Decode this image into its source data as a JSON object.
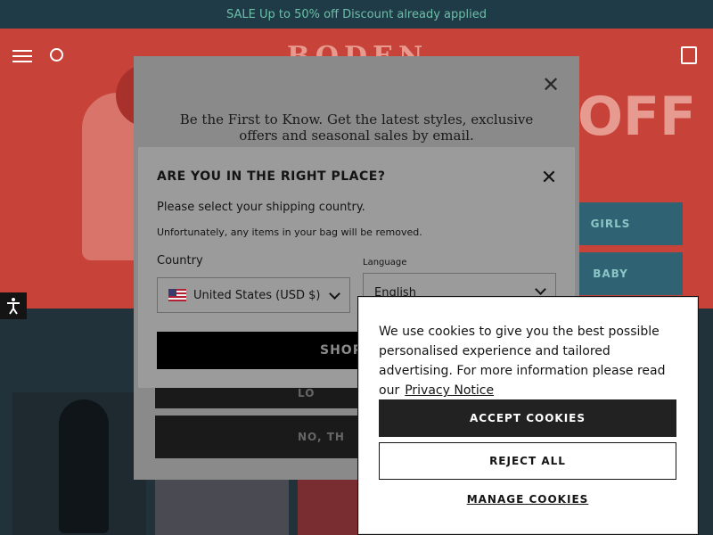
{
  "announcement": {
    "text": "SALE Up to 50% off Discount already applied"
  },
  "header": {
    "brand": "BODEN",
    "hero_text": "OFF"
  },
  "categories": [
    {
      "label": "GIRLS"
    },
    {
      "label": "BABY"
    }
  ],
  "newsletter": {
    "text": "Be the First to Know. Get the latest styles, exclusive offers and seasonal sales by email.",
    "btn_yes": "YES, I'D LO",
    "btn_no": "NO, TH",
    "close_icon": "close-icon"
  },
  "country_modal": {
    "title": "ARE YOU IN THE RIGHT PLACE?",
    "subtitle": "Please select your shipping country.",
    "warning": "Unfortunately, any items in your bag will be removed.",
    "country_label": "Country",
    "country_value": "United States (USD $)",
    "language_label": "Language",
    "language_value": "English",
    "shop_button": "SHOP"
  },
  "cookie_banner": {
    "text": "We use cookies to give you the best possible personalised experience and tailored advertising. For more information please read our",
    "link": "Privacy Notice",
    "accept": "ACCEPT COOKIES",
    "reject": "REJECT ALL",
    "manage": "MANAGE COOKIES"
  },
  "accessibility": {
    "icon": "accessibility-icon"
  },
  "colors": {
    "announce_bg": "#1f3b47",
    "hero_bg": "#c7433a",
    "category_bg": "#2f6272",
    "overlay_gray": "#9b9b9b",
    "accept_bg": "#222222"
  }
}
